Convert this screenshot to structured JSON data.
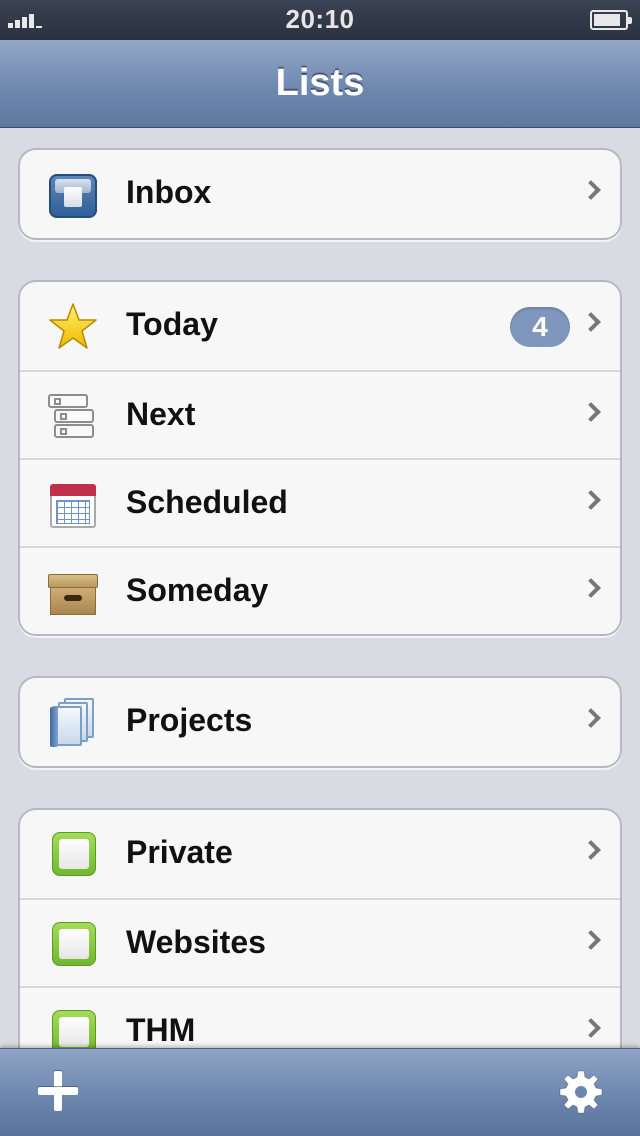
{
  "status_bar": {
    "time": "20:10",
    "signal_icon": "signal-bars-icon",
    "battery_icon": "battery-icon"
  },
  "nav": {
    "title": "Lists"
  },
  "groups": [
    {
      "items": [
        {
          "label": "Inbox",
          "icon": "inbox-icon"
        }
      ]
    },
    {
      "items": [
        {
          "label": "Today",
          "icon": "star-icon",
          "badge": "4"
        },
        {
          "label": "Next",
          "icon": "next-cards-icon"
        },
        {
          "label": "Scheduled",
          "icon": "calendar-icon"
        },
        {
          "label": "Someday",
          "icon": "archive-box-icon"
        }
      ]
    },
    {
      "items": [
        {
          "label": "Projects",
          "icon": "projects-folder-icon"
        }
      ]
    },
    {
      "items": [
        {
          "label": "Private",
          "icon": "green-checkbox-icon"
        },
        {
          "label": "Websites",
          "icon": "green-checkbox-icon"
        },
        {
          "label": "THM",
          "icon": "green-checkbox-icon"
        }
      ]
    }
  ],
  "toolbar": {
    "add_icon": "plus-icon",
    "settings_icon": "gear-icon"
  },
  "colors": {
    "nav_bar": "#7890b6",
    "badge": "#7f97bd",
    "background": "#d8dbe1",
    "checkbox_green": "#8ccc46"
  }
}
